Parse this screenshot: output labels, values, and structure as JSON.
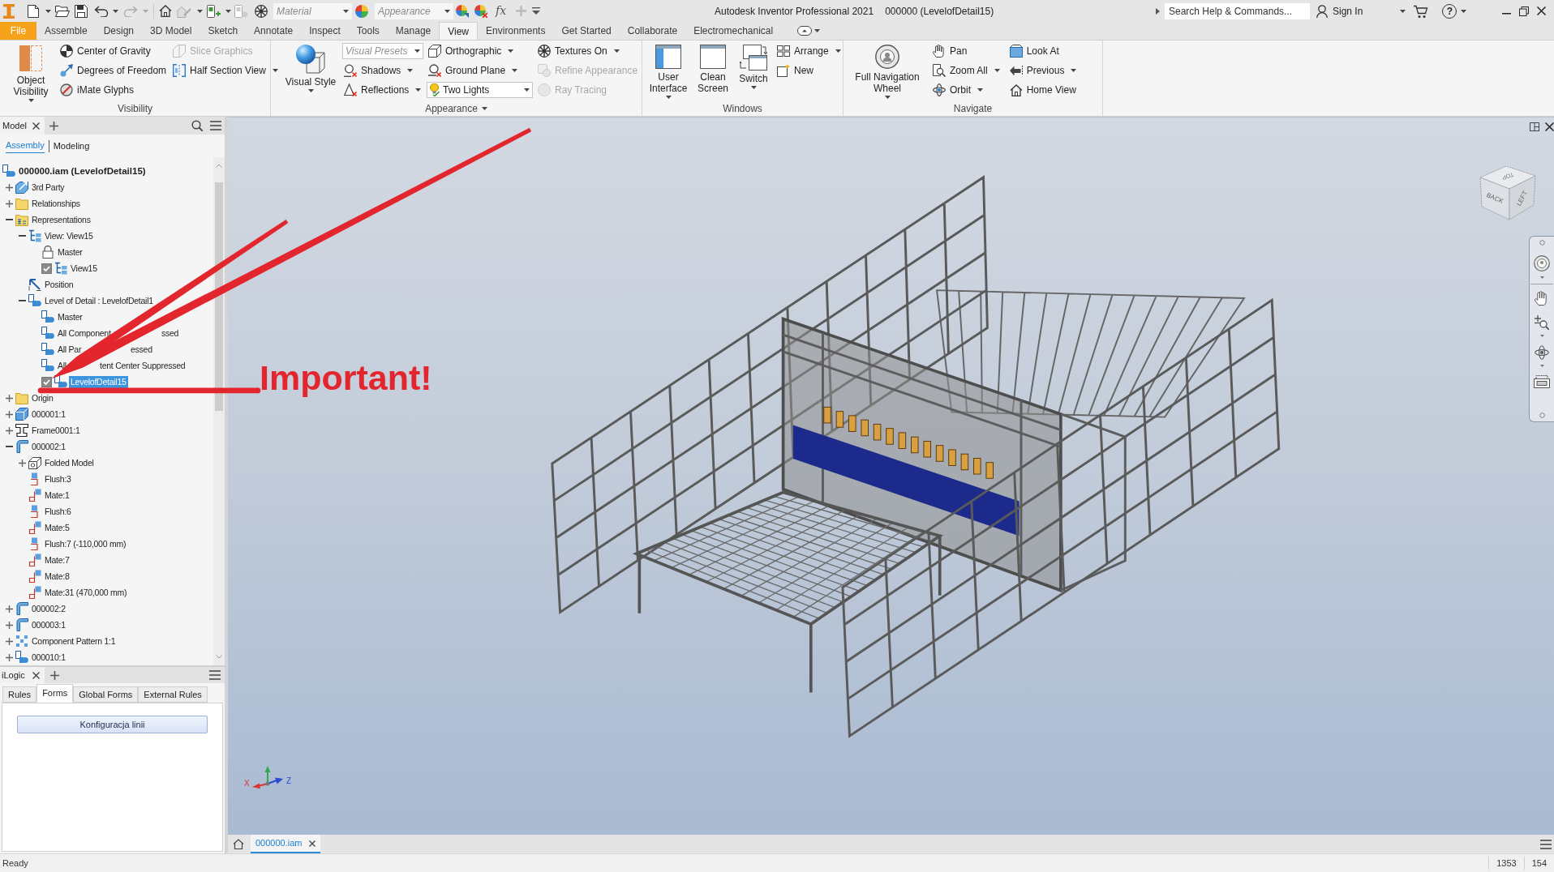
{
  "title_bar": {
    "material": {
      "placeholder": "Material"
    },
    "appearance": {
      "placeholder": "Appearance"
    },
    "formula": "fx",
    "title": "Autodesk Inventor Professional 2021",
    "document": "000000 (LevelofDetail15)",
    "search": {
      "placeholder": "Search Help & Commands..."
    },
    "sign_in": "Sign In",
    "help": "?"
  },
  "ribbon_tabs": [
    {
      "label": "File",
      "kind": "menu",
      "selected": false
    },
    {
      "label": "Assemble",
      "kind": "tab",
      "selected": false
    },
    {
      "label": "Design",
      "kind": "tab",
      "selected": false
    },
    {
      "label": "3D Model",
      "kind": "tab",
      "selected": false
    },
    {
      "label": "Sketch",
      "kind": "tab",
      "selected": false
    },
    {
      "label": "Annotate",
      "kind": "tab",
      "selected": false
    },
    {
      "label": "Inspect",
      "kind": "tab",
      "selected": false
    },
    {
      "label": "Tools",
      "kind": "tab",
      "selected": false
    },
    {
      "label": "Manage",
      "kind": "tab",
      "selected": false
    },
    {
      "label": "View",
      "kind": "tab",
      "selected": true
    },
    {
      "label": "Environments",
      "kind": "tab",
      "selected": false
    },
    {
      "label": "Get Started",
      "kind": "tab",
      "selected": false
    },
    {
      "label": "Collaborate",
      "kind": "tab",
      "selected": false
    },
    {
      "label": "Electromechanical",
      "kind": "tab",
      "selected": false
    }
  ],
  "ribbon_panels": [
    {
      "label": "Visibility",
      "menu": false,
      "columns": [
        {
          "items": [
            {
              "kind": "large",
              "label": "Object Visibility",
              "dropdown": true,
              "disabled": false
            }
          ]
        },
        {
          "items": [
            {
              "kind": "small",
              "label": "Center of Gravity",
              "dropdown": false,
              "disabled": false
            },
            {
              "kind": "small",
              "label": "Degrees of Freedom",
              "dropdown": false,
              "disabled": false
            },
            {
              "kind": "small",
              "label": "iMate Glyphs",
              "dropdown": false,
              "disabled": false
            }
          ]
        },
        {
          "items": [
            {
              "kind": "small",
              "label": "Slice Graphics",
              "dropdown": false,
              "disabled": true
            },
            {
              "kind": "small",
              "label": "Half Section View",
              "dropdown": true,
              "disabled": false
            }
          ]
        }
      ]
    },
    {
      "label": "Appearance",
      "menu": true,
      "columns": [
        {
          "items": [
            {
              "kind": "large",
              "label": "Visual Style",
              "dropdown": true,
              "disabled": false
            }
          ]
        },
        {
          "items": [
            {
              "kind": "combo",
              "placeholder": "Visual Presets",
              "dropdown": true,
              "disabled": false
            },
            {
              "kind": "small",
              "label": "Shadows",
              "dropdown": true,
              "disabled": false
            },
            {
              "kind": "small",
              "label": "Reflections",
              "dropdown": true,
              "disabled": false
            }
          ]
        },
        {
          "items": [
            {
              "kind": "small",
              "label": "Orthographic",
              "dropdown": true,
              "disabled": false
            },
            {
              "kind": "small",
              "label": "Ground Plane",
              "dropdown": true,
              "disabled": false
            },
            {
              "kind": "combo",
              "value": "Two Lights",
              "dropdown": true,
              "disabled": false
            }
          ]
        },
        {
          "items": [
            {
              "kind": "small",
              "label": "Textures On",
              "dropdown": true,
              "disabled": false
            },
            {
              "kind": "small",
              "label": "Refine Appearance",
              "dropdown": false,
              "disabled": true
            },
            {
              "kind": "small",
              "label": "Ray Tracing",
              "dropdown": false,
              "disabled": true
            }
          ]
        }
      ]
    },
    {
      "label": "Windows",
      "menu": false,
      "columns": [
        {
          "items": [
            {
              "kind": "large",
              "label": "User Interface",
              "dropdown": true,
              "disabled": false
            }
          ]
        },
        {
          "items": [
            {
              "kind": "large",
              "label": "Clean Screen",
              "dropdown": false,
              "disabled": false
            }
          ]
        },
        {
          "items": [
            {
              "kind": "large",
              "label": "Switch",
              "dropdown": true,
              "disabled": false
            }
          ]
        },
        {
          "items": [
            {
              "kind": "small",
              "label": "Arrange",
              "dropdown": true,
              "disabled": false
            },
            {
              "kind": "small",
              "label": "New",
              "dropdown": false,
              "disabled": false
            }
          ]
        }
      ]
    },
    {
      "label": "Navigate",
      "menu": false,
      "columns": [
        {
          "items": [
            {
              "kind": "large",
              "label": "Full Navigation Wheel",
              "dropdown": true,
              "disabled": false
            }
          ]
        },
        {
          "items": [
            {
              "kind": "small",
              "label": "Pan",
              "dropdown": false,
              "disabled": false
            },
            {
              "kind": "small",
              "label": "Zoom All",
              "dropdown": true,
              "disabled": false
            },
            {
              "kind": "small",
              "label": "Orbit",
              "dropdown": true,
              "disabled": false
            }
          ]
        },
        {
          "items": [
            {
              "kind": "small",
              "label": "Look At",
              "dropdown": false,
              "disabled": false
            },
            {
              "kind": "small",
              "label": "Previous",
              "dropdown": true,
              "disabled": false
            },
            {
              "kind": "small",
              "label": "Home View",
              "dropdown": false,
              "disabled": false
            }
          ]
        }
      ]
    }
  ],
  "model_panel": {
    "tab": "Model",
    "views": [
      {
        "label": "Assembly",
        "selected": true
      },
      {
        "label": "Modeling",
        "selected": false
      }
    ],
    "tree": [
      {
        "label": "000000.iam (LevelofDetail15)",
        "kind": "assembly",
        "selected": false,
        "children": [
          {
            "label": "3rd Party",
            "kind": "third_party",
            "expanded": false,
            "selected": false
          },
          {
            "label": "Relationships",
            "kind": "folder",
            "expanded": false,
            "selected": false
          },
          {
            "label": "Representations",
            "kind": "representations",
            "expanded": true,
            "selected": false,
            "children": [
              {
                "label": "View: View15",
                "kind": "view",
                "expanded": true,
                "selected": false,
                "children": [
                  {
                    "label": "Master",
                    "kind": "lock",
                    "selected": false
                  },
                  {
                    "label": "View15",
                    "kind": "view",
                    "checked": true,
                    "selected": false
                  }
                ]
              },
              {
                "label": "Position",
                "kind": "position",
                "selected": false
              },
              {
                "label": "Level of Detail : LevelofDetail1",
                "kind": "lod",
                "expanded": true,
                "selected": false,
                "children": [
                  {
                    "label": "Master",
                    "kind": "lod",
                    "selected": false
                  },
                  {
                    "label": "All Component",
                    "label_tail": "ssed",
                    "kind": "lod",
                    "selected": false
                  },
                  {
                    "label": "All Par",
                    "label_tail": "essed",
                    "kind": "lod",
                    "selected": false
                  },
                  {
                    "label": "All",
                    "label_tail": "tent Center Suppressed",
                    "kind": "lod",
                    "selected": false
                  },
                  {
                    "label": "LevelofDetail15",
                    "kind": "lod",
                    "checked": true,
                    "selected": true
                  }
                ]
              }
            ]
          },
          {
            "label": "Origin",
            "kind": "folder",
            "expanded": false,
            "selected": false
          },
          {
            "label": "000001:1",
            "kind": "part",
            "expanded": false,
            "selected": false
          },
          {
            "label": "Frame0001:1",
            "kind": "frame",
            "expanded": false,
            "selected": false
          },
          {
            "label": "000002:1",
            "kind": "sheet_metal",
            "expanded": true,
            "selected": false,
            "children": [
              {
                "label": "Folded Model",
                "kind": "folded",
                "expanded": false,
                "selected": false
              },
              {
                "label": "Flush:3",
                "kind": "flush",
                "selected": false
              },
              {
                "label": "Mate:1",
                "kind": "mate",
                "selected": false
              },
              {
                "label": "Flush:6",
                "kind": "flush",
                "selected": false
              },
              {
                "label": "Mate:5",
                "kind": "mate",
                "selected": false
              },
              {
                "label": "Flush:7 (-110,000 mm)",
                "kind": "flush",
                "selected": false
              },
              {
                "label": "Mate:7",
                "kind": "mate",
                "selected": false
              },
              {
                "label": "Mate:8",
                "kind": "mate",
                "selected": false
              },
              {
                "label": "Mate:31 (470,000 mm)",
                "kind": "mate",
                "selected": false
              }
            ]
          },
          {
            "label": "000002:2",
            "kind": "sheet_metal",
            "expanded": false,
            "selected": false
          },
          {
            "label": "000003:1",
            "kind": "sheet_metal",
            "expanded": false,
            "selected": false
          },
          {
            "label": "Component Pattern 1:1",
            "kind": "pattern",
            "expanded": false,
            "selected": false
          },
          {
            "label": "000010:1",
            "kind": "assembly",
            "expanded": false,
            "selected": false
          }
        ]
      }
    ]
  },
  "ilogic_panel": {
    "tab": "iLogic",
    "tabs": [
      {
        "label": "Rules",
        "selected": false
      },
      {
        "label": "Forms",
        "selected": true
      },
      {
        "label": "Global Forms",
        "selected": false
      },
      {
        "label": "External Rules",
        "selected": false
      }
    ],
    "forms": [
      "Konfiguracja linii"
    ]
  },
  "viewport": {
    "view_cube": [
      "TOP",
      "BACK",
      "LEFT"
    ],
    "axes": [
      "X",
      "Z"
    ],
    "annotation": "Important!"
  },
  "document_tabs": [
    {
      "label": "000000.iam",
      "selected": true
    }
  ],
  "status_bar": {
    "message": "Ready",
    "fields": [
      "1353",
      "154"
    ]
  }
}
